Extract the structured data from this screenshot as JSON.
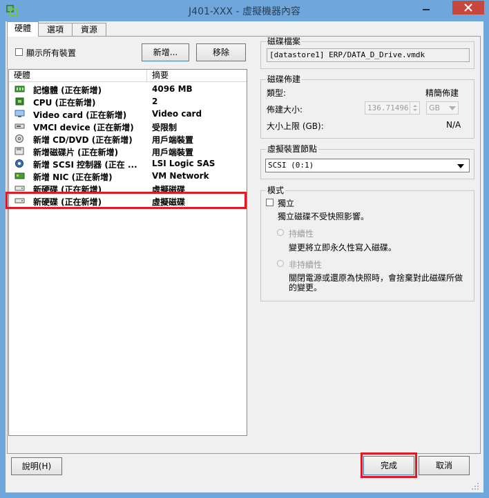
{
  "window": {
    "title": "J401-XXX - 虛擬機器內容"
  },
  "tabs": [
    {
      "label": "硬體"
    },
    {
      "label": "選項"
    },
    {
      "label": "資源"
    }
  ],
  "hardware": {
    "show_all_label": "顯示所有裝置",
    "add_button": "新增...",
    "remove_button": "移除",
    "columns": {
      "hardware": "硬體",
      "summary": "摘要"
    },
    "rows": [
      {
        "name": "記憶體 (正在新增)",
        "summary": "4096 MB",
        "icon": "memory-icon"
      },
      {
        "name": "CPU (正在新增)",
        "summary": "2",
        "icon": "cpu-icon"
      },
      {
        "name": "Video card (正在新增)",
        "summary": "Video card",
        "icon": "monitor-icon"
      },
      {
        "name": "VMCI device (正在新增)",
        "summary": "受限制",
        "icon": "device-icon"
      },
      {
        "name": "新增 CD/DVD (正在新增)",
        "summary": "用戶端裝置",
        "icon": "cd-dvd-icon"
      },
      {
        "name": "新增磁碟片 (正在新增)",
        "summary": "用戶端裝置",
        "icon": "floppy-icon"
      },
      {
        "name": "新增 SCSI 控制器 (正在 ...",
        "summary": "LSI Logic SAS",
        "icon": "scsi-controller-icon"
      },
      {
        "name": "新增 NIC (正在新增)",
        "summary": "VM Network",
        "icon": "network-card-icon"
      },
      {
        "name": "新硬碟 (正在新增)",
        "summary": "虛擬磁碟",
        "icon": "hard-disk-icon"
      },
      {
        "name": "新硬碟 (正在新增)",
        "summary": "虛擬磁碟",
        "icon": "hard-disk-icon"
      }
    ],
    "selected_index": 9
  },
  "disk_file": {
    "legend": "磁碟檔案",
    "path": "[datastore1] ERP/DATA_D_Drive.vmdk"
  },
  "disk_provisioning": {
    "legend": "磁碟佈建",
    "type_label": "類型:",
    "type_value": "精簡佈建",
    "size_label": "佈建大小:",
    "size_value": "136.71496",
    "size_unit": "GB",
    "max_label": "大小上限 (GB):",
    "max_value": "N/A"
  },
  "virtual_device_node": {
    "legend": "虛擬裝置節點",
    "value": "SCSI (0:1)"
  },
  "mode": {
    "legend": "模式",
    "independent_label": "獨立",
    "independent_desc": "獨立磁碟不受快照影響。",
    "persistent_label": "持續性",
    "persistent_desc": "變更將立即永久性寫入磁碟。",
    "nonpersistent_label": "非持續性",
    "nonpersistent_desc_line1": "關閉電源或還原為快照時，會捨棄對此磁碟所做",
    "nonpersistent_desc_line2": "的變更。"
  },
  "footer": {
    "help": "說明(H)",
    "finish": "完成",
    "cancel": "取消"
  },
  "colors": {
    "highlight": "#e01a24",
    "titlebar": "#6fa7dd",
    "close": "#c7463d"
  }
}
